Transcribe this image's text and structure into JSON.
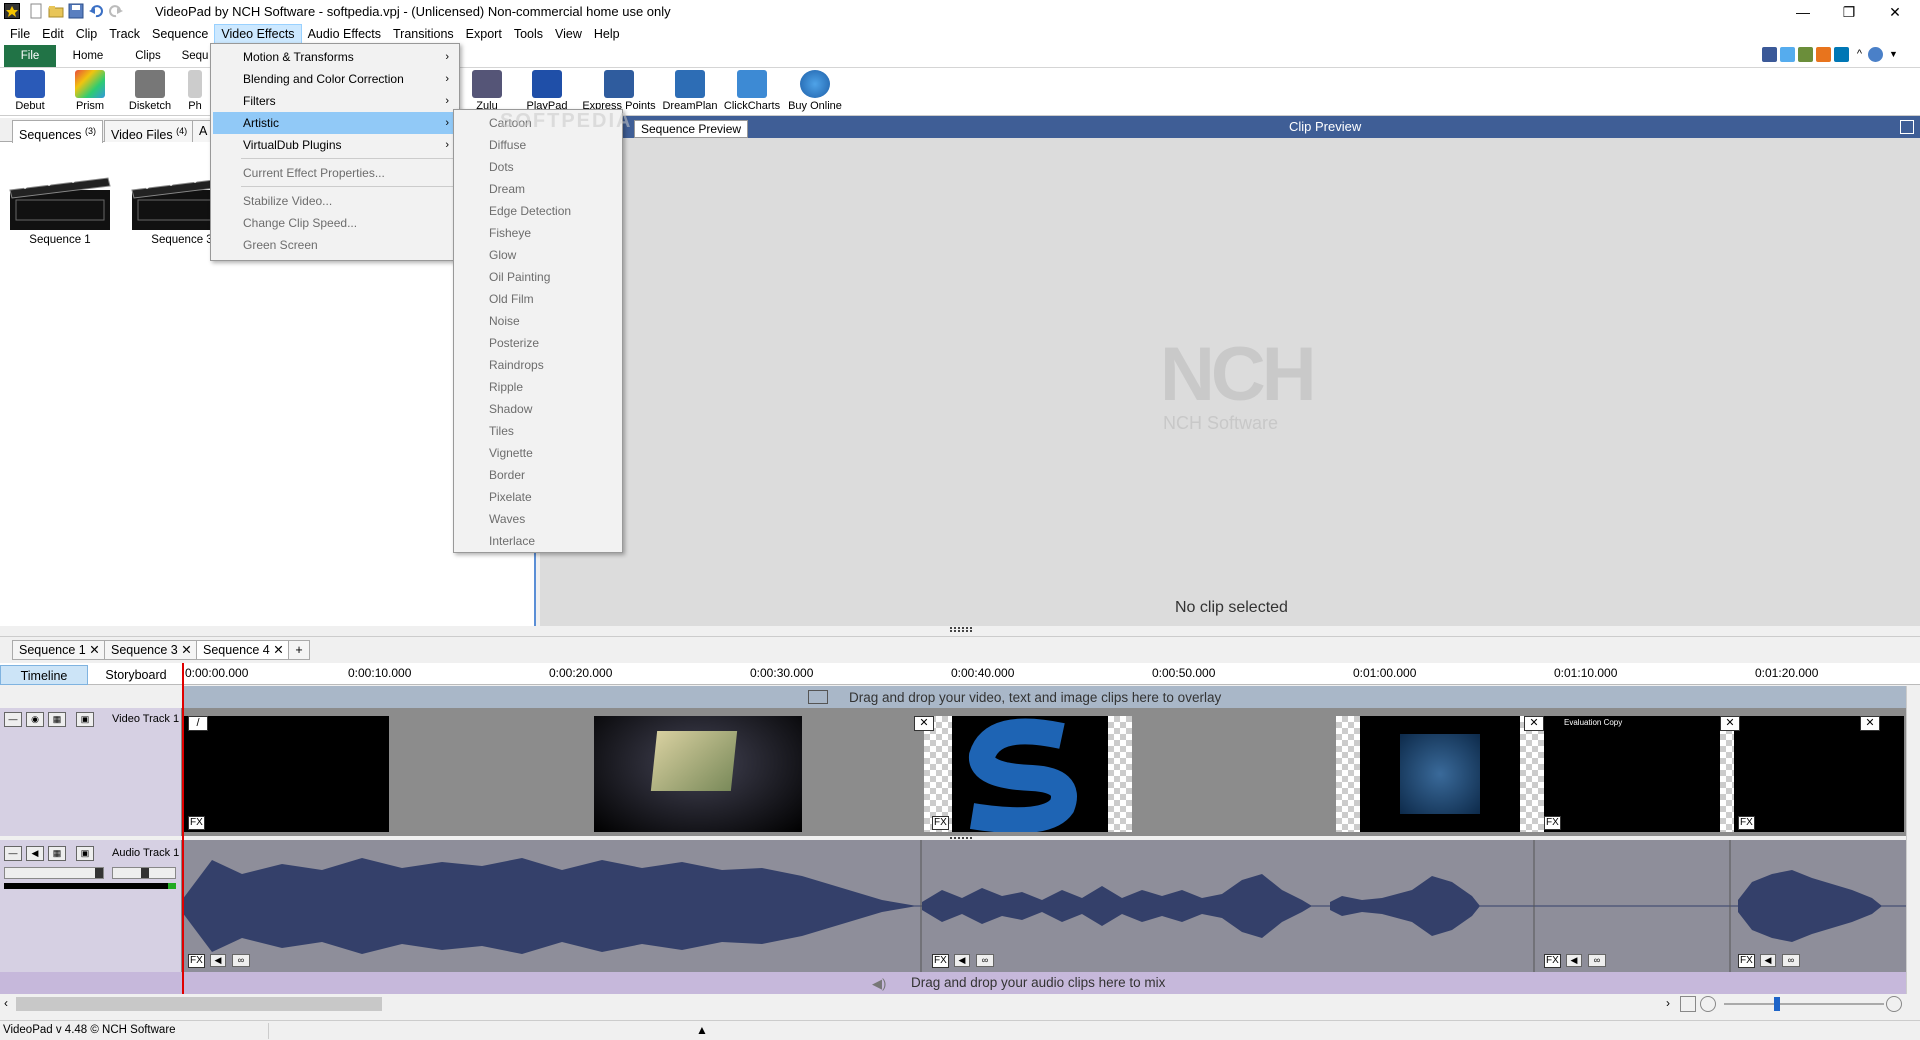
{
  "window": {
    "title": "VideoPad by NCH Software - softpedia.vpj - (Unlicensed) Non-commercial home use only",
    "minimize": "—",
    "restore": "❐",
    "close": "✕"
  },
  "menubar": [
    "File",
    "Edit",
    "Clip",
    "Track",
    "Sequence",
    "Video Effects",
    "Audio Effects",
    "Transitions",
    "Export",
    "Tools",
    "View",
    "Help"
  ],
  "ribbon_tabs": {
    "file": "File",
    "home": "Home",
    "clips": "Clips",
    "sequence": "Sequ"
  },
  "toolbar": {
    "debut": "Debut",
    "prism": "Prism",
    "disketch": "Disketch",
    "ph": "Ph",
    "zulu": "Zulu",
    "playpad": "PlayPad",
    "express_points": "Express Points",
    "dreamplan": "DreamPlan",
    "clickcharts": "ClickCharts",
    "buy_online": "Buy Online"
  },
  "left_tabs": {
    "sequences": "Sequences",
    "sequences_count": "(3)",
    "video_files": "Video Files",
    "video_files_count": "(4)",
    "a": "A"
  },
  "bins": [
    {
      "label": "Sequence 1"
    },
    {
      "label": "Sequence 3"
    }
  ],
  "preview": {
    "tab": "Sequence Preview",
    "title": "Clip Preview",
    "logo": "NCH",
    "logo_sub": "NCH Software",
    "status": "No clip selected"
  },
  "sequence_tabs": [
    "Sequence 1",
    "Sequence 3",
    "Sequence 4"
  ],
  "sequence_tab_add": "+",
  "timeline": {
    "timeline_label": "Timeline",
    "storyboard_label": "Storyboard",
    "ticks": [
      "0:00:00.000",
      "0:00:10.000",
      "0:00:20.000",
      "0:00:30.000",
      "0:00:40.000",
      "0:00:50.000",
      "0:01:00.000",
      "0:01:10.000",
      "0:01:20.000"
    ],
    "overlay_hint": "Drag and drop your video, text and image clips here to overlay",
    "video_track": "Video Track 1",
    "audio_track": "Audio Track 1",
    "audio_hint": "Drag and drop your audio clips here to mix",
    "fx": "FX",
    "watermark": "Evaluation Copy"
  },
  "video_effects_menu": [
    {
      "label": "Motion & Transforms",
      "arrow": "›",
      "disabled": false
    },
    {
      "label": "Blending and Color Correction",
      "arrow": "›",
      "disabled": false
    },
    {
      "label": "Filters",
      "arrow": "›",
      "disabled": false
    },
    {
      "label": "Artistic",
      "arrow": "›",
      "disabled": false
    },
    {
      "label": "VirtualDub Plugins",
      "arrow": "›",
      "disabled": false
    },
    {
      "label": "Current Effect Properties...",
      "disabled": true
    },
    {
      "label": "Stabilize Video...",
      "disabled": true
    },
    {
      "label": "Change Clip Speed...",
      "disabled": true
    },
    {
      "label": "Green Screen",
      "disabled": true
    }
  ],
  "artistic_submenu": [
    "Cartoon",
    "Diffuse",
    "Dots",
    "Dream",
    "Edge Detection",
    "Fisheye",
    "Glow",
    "Oil Painting",
    "Old Film",
    "Noise",
    "Posterize",
    "Raindrops",
    "Ripple",
    "Shadow",
    "Tiles",
    "Vignette",
    "Border",
    "Pixelate",
    "Waves",
    "Interlace"
  ],
  "softpedia_watermark": "SOFTPEDIA",
  "status": {
    "version": "VideoPad v 4.48 © NCH Software"
  },
  "colors": {
    "accent": "#3f5e96",
    "file_tab": "#217346",
    "menu_highlight": "#91c9f7",
    "playhead": "#e00000"
  }
}
